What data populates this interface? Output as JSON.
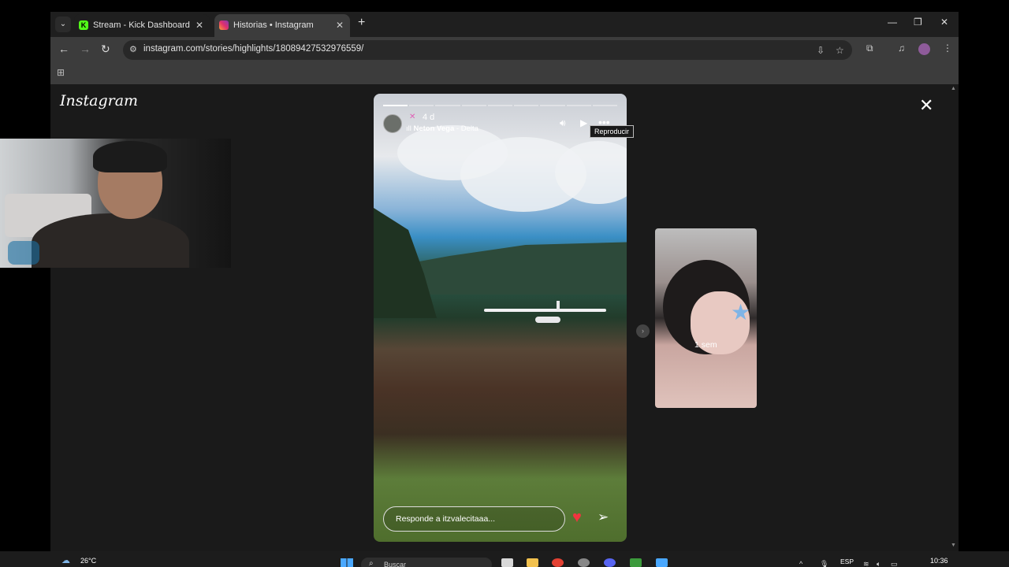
{
  "browser": {
    "tabs": [
      {
        "title": "Stream - Kick Dashboard",
        "favicon": "kick-icon",
        "active": false
      },
      {
        "title": "Historias • Instagram",
        "favicon": "instagram-icon",
        "active": true
      }
    ],
    "address_url": "instagram.com/stories/highlights/18089427532976559/"
  },
  "instagram": {
    "logo_text": "Instagram",
    "story": {
      "time": "4 d",
      "music_artist": "Neton Vega",
      "music_track": "Delta",
      "music_separator": " - ",
      "tooltip": "Reproducir",
      "reply_placeholder": "Responde a itzvalecitaaa...",
      "progress_total": 9,
      "progress_done": 1
    },
    "next_story_label": "1 sem"
  },
  "taskbar": {
    "temperature": "26°C",
    "search_label": "Buscar",
    "language": "ESP",
    "time": "10:36"
  },
  "colors": {
    "accent_heart": "#f2343f",
    "kick_green": "#53fc18"
  }
}
